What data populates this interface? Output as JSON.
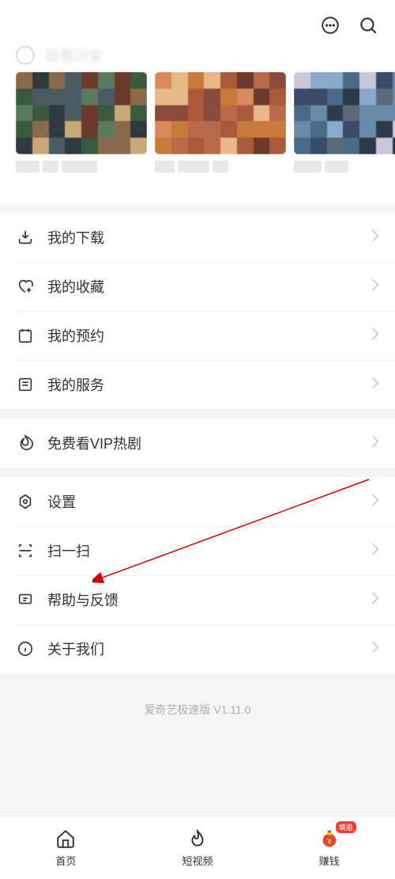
{
  "header": {
    "chat_icon": "chat",
    "search_icon": "search"
  },
  "menu": {
    "group1": [
      {
        "icon": "download",
        "label": "我的下载"
      },
      {
        "icon": "heart-plus",
        "label": "我的收藏"
      },
      {
        "icon": "calendar",
        "label": "我的预约"
      },
      {
        "icon": "list",
        "label": "我的服务"
      }
    ],
    "group2": [
      {
        "icon": "fire",
        "label": "免费看VIP热剧"
      }
    ],
    "group3": [
      {
        "icon": "gear",
        "label": "设置"
      },
      {
        "icon": "scan",
        "label": "扫一扫"
      },
      {
        "icon": "feedback",
        "label": "帮助与反馈"
      },
      {
        "icon": "info",
        "label": "关于我们"
      }
    ]
  },
  "version": "爱奇艺极速版 V1.11.0",
  "bottomNav": {
    "home": "首页",
    "shortVideo": "短视频",
    "earn": "赚钱",
    "earnBadge": "填邀"
  }
}
